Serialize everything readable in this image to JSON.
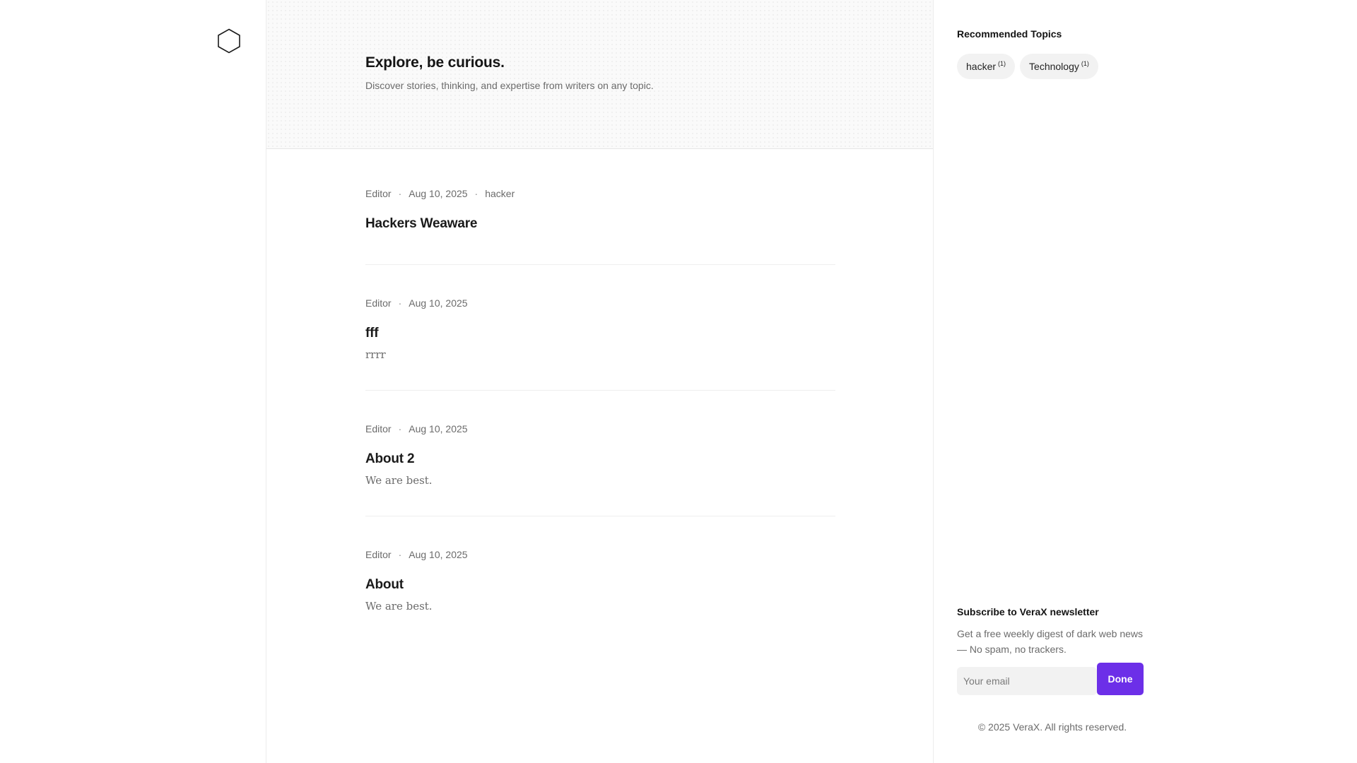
{
  "hero": {
    "title": "Explore, be curious.",
    "subtitle": "Discover stories, thinking, and expertise from writers on any topic."
  },
  "articles": [
    {
      "author": "Editor",
      "date": "Aug 10, 2025",
      "tag": "hacker",
      "title": "Hackers Weaware",
      "excerpt": ""
    },
    {
      "author": "Editor",
      "date": "Aug 10, 2025",
      "tag": "",
      "title": "fff",
      "excerpt": "rrrr"
    },
    {
      "author": "Editor",
      "date": "Aug 10, 2025",
      "tag": "",
      "title": "About 2",
      "excerpt": "We are best."
    },
    {
      "author": "Editor",
      "date": "Aug 10, 2025",
      "tag": "",
      "title": "About",
      "excerpt": "We are best."
    }
  ],
  "sidebar": {
    "topics_heading": "Recommended Topics",
    "topics": [
      {
        "label": "hacker",
        "count": "(1)"
      },
      {
        "label": "Technology",
        "count": "(1)"
      }
    ],
    "newsletter": {
      "heading": "Subscribe to VeraX newsletter",
      "description": "Get a free weekly digest of dark web news — No spam, no trackers.",
      "email_placeholder": "Your email",
      "email_value": "",
      "button_label": "Done"
    },
    "footer": "© 2025 VeraX. All rights reserved."
  },
  "meta_separator": "·",
  "colors": {
    "accent": "#6c2fe8",
    "text_primary": "#1a1a1a",
    "text_secondary": "#6b6b6b",
    "pill_bg": "#f2f2f2"
  },
  "icons": {
    "logo": "hexagon-logo-icon"
  }
}
